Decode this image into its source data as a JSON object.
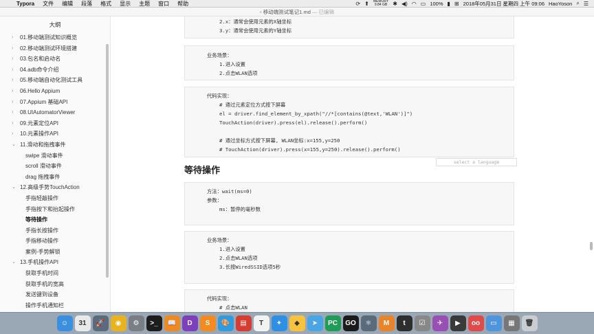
{
  "menubar": {
    "app_name": "Typora",
    "menus": [
      "文件",
      "编辑",
      "段落",
      "格式",
      "显示",
      "主题",
      "窗口",
      "帮助"
    ],
    "memory_label": "MEMORY",
    "memory_value": "9.84 GB",
    "battery": "100%",
    "datetime": "2018年05月31日 星期四 上午 09:06",
    "user": "HaoYoson"
  },
  "window": {
    "title": "移动端测试笔记1.md",
    "saved_status": "— 已编辑"
  },
  "sidebar": {
    "title": "大纲",
    "items": [
      {
        "label": "01.移动端测试知识概览",
        "level": 1,
        "chevron": "›"
      },
      {
        "label": "02.移动端测试环境搭建",
        "level": 1,
        "chevron": "›"
      },
      {
        "label": "03.包名和启动名",
        "level": 1,
        "chevron": "›"
      },
      {
        "label": "04.adb命令介绍",
        "level": 1,
        "chevron": "›"
      },
      {
        "label": "05.移动端自动化测试工具",
        "level": 1,
        "chevron": "›"
      },
      {
        "label": "06.Hello Appium",
        "level": 1,
        "chevron": "›"
      },
      {
        "label": "07.Appium 基础API",
        "level": 1,
        "chevron": "›"
      },
      {
        "label": "08.UIAutomatorViewer",
        "level": 1,
        "chevron": "›"
      },
      {
        "label": "09.元素定位API",
        "level": 1,
        "chevron": "›"
      },
      {
        "label": "10.元素操作API",
        "level": 1,
        "chevron": "›"
      },
      {
        "label": "11.滑动和拖拽事件",
        "level": 1,
        "chevron": "⌄"
      },
      {
        "label": "swipe 滑动事件",
        "level": 2,
        "chevron": ""
      },
      {
        "label": "scroll 滑动事件",
        "level": 2,
        "chevron": ""
      },
      {
        "label": "drag 拖拽事件",
        "level": 2,
        "chevron": ""
      },
      {
        "label": "12.高级手势TouchAction",
        "level": 1,
        "chevron": "⌄"
      },
      {
        "label": "手指轻敲操作",
        "level": 2,
        "chevron": ""
      },
      {
        "label": "手指按下和抬起操作",
        "level": 2,
        "chevron": ""
      },
      {
        "label": "等待操作",
        "level": 2,
        "chevron": "",
        "active": true
      },
      {
        "label": "手指长按操作",
        "level": 2,
        "chevron": ""
      },
      {
        "label": "手指移动操作",
        "level": 2,
        "chevron": ""
      },
      {
        "label": "案例-手势解锁",
        "level": 2,
        "chevron": ""
      },
      {
        "label": "13.手机操作API",
        "level": 1,
        "chevron": "⌄"
      },
      {
        "label": "获取手机时间",
        "level": 2,
        "chevron": ""
      },
      {
        "label": "获取手机的宽高",
        "level": 2,
        "chevron": ""
      },
      {
        "label": "发送键到设备",
        "level": 2,
        "chevron": ""
      },
      {
        "label": "操作手机通知栏",
        "level": 2,
        "chevron": ""
      }
    ]
  },
  "content": {
    "block1": [
      "2.x：通常会使用元素的X轴坐标",
      "3.y：通常会使用元素的Y轴坐标"
    ],
    "block2": [
      "业务场景：",
      "1.进入设置",
      "2.点击WLAN选项"
    ],
    "block3": [
      "代码实现：",
      "# 通过元素定位方式按下屏幕",
      "el = driver.find_element_by_xpath(\"//*[contains(@text,'WLAN')]\")",
      "TouchAction(driver).press(el).release().perform()",
      "# 通过坐标方式按下屏幕, WLAN坐标:x=155,y=250",
      "# TouchAction(driver).press(x=155,y=250).release().perform()"
    ],
    "lang_placeholder": "select a language",
    "heading": "等待操作",
    "block4": [
      "方法：wait(ms=0)",
      "参数：",
      "ms：暂停的毫秒数"
    ],
    "block5": [
      "业务场景：",
      "1.进入设置",
      "2.点击WLAN选项",
      "3.长按WiredSSID选项5秒"
    ],
    "block6": [
      "代码实现：",
      "# 点击WLAN"
    ]
  },
  "dock": {
    "icons": [
      {
        "name": "finder-icon",
        "color": "#3b8fe0",
        "glyph": "☺"
      },
      {
        "name": "calendar-icon",
        "color": "#e9e9e9",
        "glyph": "31"
      },
      {
        "name": "launchpad-icon",
        "color": "#5c6b7c",
        "glyph": "🚀"
      },
      {
        "name": "chrome-icon",
        "color": "#e8b31c",
        "glyph": "◉"
      },
      {
        "name": "system-preferences-icon",
        "color": "#7a7f86",
        "glyph": "⚙"
      },
      {
        "name": "terminal-icon",
        "color": "#1d1d1d",
        "glyph": ">_"
      },
      {
        "name": "books-icon",
        "color": "#ef8a1e",
        "glyph": "📖"
      },
      {
        "name": "dash-icon",
        "color": "#7e3fbf",
        "glyph": "D"
      },
      {
        "name": "sublime-icon",
        "color": "#f58b1f",
        "glyph": "S"
      },
      {
        "name": "paint-icon",
        "color": "#2f9be0",
        "glyph": "🎨"
      },
      {
        "name": "books2-icon",
        "color": "#d83b2f",
        "glyph": "▤"
      },
      {
        "name": "typora-icon",
        "color": "#f2f2f2",
        "glyph": "T"
      },
      {
        "name": "safari-icon",
        "color": "#2d8fe6",
        "glyph": "✦"
      },
      {
        "name": "sketch-icon",
        "color": "#f7c33a",
        "glyph": "◆"
      },
      {
        "name": "arrow-icon",
        "color": "#4aa5e6",
        "glyph": "➤"
      },
      {
        "name": "pycharm-icon",
        "color": "#1f9d55",
        "glyph": "PC"
      },
      {
        "name": "goland-icon",
        "color": "#1b1b1b",
        "glyph": "GO"
      },
      {
        "name": "atom-icon",
        "color": "#5a6b7c",
        "glyph": "⚛"
      },
      {
        "name": "matlab-icon",
        "color": "#e8852b",
        "glyph": "M"
      },
      {
        "name": "typeeto-icon",
        "color": "#2e2e2e",
        "glyph": "t"
      },
      {
        "name": "scripts-icon",
        "color": "#888",
        "glyph": "☑"
      },
      {
        "name": "android-icon",
        "color": "#9a4fb4",
        "glyph": "✈"
      },
      {
        "name": "video-icon",
        "color": "#3a3a3a",
        "glyph": "▶"
      },
      {
        "name": "mindnode-icon",
        "color": "#e24a4a",
        "glyph": "oo"
      },
      {
        "name": "folder-icon",
        "color": "#4f95dd",
        "glyph": "▭"
      },
      {
        "name": "downloads-icon",
        "color": "#777",
        "glyph": "▦"
      },
      {
        "name": "trash-icon",
        "color": "#c9ccd0",
        "glyph": "🗑"
      }
    ]
  }
}
